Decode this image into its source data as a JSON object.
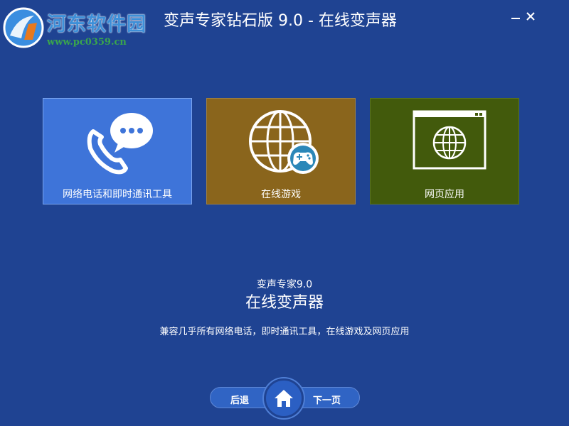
{
  "watermark": {
    "site_name": "河东软件园",
    "site_url": "www.pc0359.cn"
  },
  "window": {
    "title": "变声专家钻石版 9.0 - 在线变声器",
    "minimize_label": "−",
    "close_label": "×"
  },
  "tiles": [
    {
      "label": "网络电话和即时通讯工具",
      "icon": "phone-chat-icon",
      "color": "#3e74d9"
    },
    {
      "label": "在线游戏",
      "icon": "globe-gamepad-icon",
      "color": "#8a651c"
    },
    {
      "label": "网页应用",
      "icon": "browser-globe-icon",
      "color": "#425a0c"
    }
  ],
  "info": {
    "subtitle": "变声专家9.0",
    "title": "在线变声器",
    "description": "兼容几乎所有网络电话，即时通讯工具，在线游戏及网页应用"
  },
  "nav": {
    "back_label": "后退",
    "next_label": "下一页",
    "home_icon": "home-icon"
  },
  "colors": {
    "background": "#1f4392",
    "accent": "#3064c4"
  }
}
